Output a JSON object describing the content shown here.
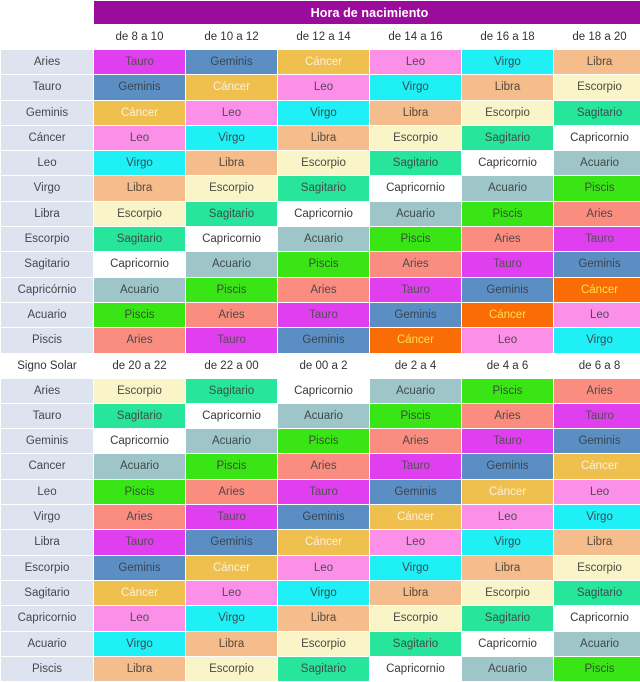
{
  "title": "Hora de nacimiento",
  "solar_sign_label": "Signo Solar",
  "sign_colors": {
    "Aries": "#FA8C80",
    "Tauro": "#E03FF0",
    "Geminis": "#5B8FC4",
    "Cáncer": "#EFC04E",
    "Cáncer_alt": "#F96C06",
    "Leo": "#FC8FE8",
    "Virgo": "#1FF0F5",
    "Libra": "#F5BC8C",
    "Escorpio": "#FAF5C8",
    "Sagitario": "#27E59A",
    "Capricornio": "#FFFFFF",
    "Acuario": "#9EC5C8",
    "Piscis": "#3AE515",
    "title_bar": "#9C0C9C",
    "row_label": "#DDE3EF"
  },
  "section1": {
    "columns": [
      "de 8 a 10",
      "de 10 a 12",
      "de 12 a 14",
      "de 14 a 16",
      "de 16 a 18",
      "de 18 a 20"
    ],
    "rows": [
      {
        "label": "Aries",
        "cells": [
          {
            "t": "Tauro",
            "c": "s-tauro"
          },
          {
            "t": "Geminis",
            "c": "s-geminis"
          },
          {
            "t": "Cáncer",
            "c": "s-cancer-gold"
          },
          {
            "t": "Leo",
            "c": "s-leo"
          },
          {
            "t": "Virgo",
            "c": "s-virgo"
          },
          {
            "t": "Libra",
            "c": "s-libra"
          }
        ]
      },
      {
        "label": "Tauro",
        "cells": [
          {
            "t": "Geminis",
            "c": "s-geminis"
          },
          {
            "t": "Cáncer",
            "c": "s-cancer-gold"
          },
          {
            "t": "Leo",
            "c": "s-leo"
          },
          {
            "t": "Virgo",
            "c": "s-virgo"
          },
          {
            "t": "Libra",
            "c": "s-libra"
          },
          {
            "t": "Escorpio",
            "c": "s-escorpio"
          }
        ]
      },
      {
        "label": "Geminis",
        "cells": [
          {
            "t": "Cáncer",
            "c": "s-cancer-gold"
          },
          {
            "t": "Leo",
            "c": "s-leo"
          },
          {
            "t": "Virgo",
            "c": "s-virgo"
          },
          {
            "t": "Libra",
            "c": "s-libra"
          },
          {
            "t": "Escorpio",
            "c": "s-escorpio"
          },
          {
            "t": "Sagitario",
            "c": "s-sagitario"
          }
        ]
      },
      {
        "label": "Cáncer",
        "cells": [
          {
            "t": "Leo",
            "c": "s-leo"
          },
          {
            "t": "Virgo",
            "c": "s-virgo"
          },
          {
            "t": "Libra",
            "c": "s-libra"
          },
          {
            "t": "Escorpio",
            "c": "s-escorpio"
          },
          {
            "t": "Sagitario",
            "c": "s-sagitario"
          },
          {
            "t": "Capricornio",
            "c": "s-capricornio"
          }
        ]
      },
      {
        "label": "Leo",
        "cells": [
          {
            "t": "Virgo",
            "c": "s-virgo"
          },
          {
            "t": "Libra",
            "c": "s-libra"
          },
          {
            "t": "Escorpio",
            "c": "s-escorpio"
          },
          {
            "t": "Sagitario",
            "c": "s-sagitario"
          },
          {
            "t": "Capricornio",
            "c": "s-capricornio"
          },
          {
            "t": "Acuario",
            "c": "s-acuario"
          }
        ]
      },
      {
        "label": "Virgo",
        "cells": [
          {
            "t": "Libra",
            "c": "s-libra"
          },
          {
            "t": "Escorpio",
            "c": "s-escorpio"
          },
          {
            "t": "Sagitario",
            "c": "s-sagitario"
          },
          {
            "t": "Capricornio",
            "c": "s-capricornio"
          },
          {
            "t": "Acuario",
            "c": "s-acuario"
          },
          {
            "t": "Piscis",
            "c": "s-piscis"
          }
        ]
      },
      {
        "label": "Libra",
        "cells": [
          {
            "t": "Escorpio",
            "c": "s-escorpio"
          },
          {
            "t": "Sagitario",
            "c": "s-sagitario"
          },
          {
            "t": "Capricornio",
            "c": "s-capricornio"
          },
          {
            "t": "Acuario",
            "c": "s-acuario"
          },
          {
            "t": "Piscis",
            "c": "s-piscis"
          },
          {
            "t": "Aries",
            "c": "s-aries"
          }
        ]
      },
      {
        "label": "Escorpio",
        "cells": [
          {
            "t": "Sagitario",
            "c": "s-sagitario"
          },
          {
            "t": "Capricornio",
            "c": "s-capricornio"
          },
          {
            "t": "Acuario",
            "c": "s-acuario"
          },
          {
            "t": "Piscis",
            "c": "s-piscis"
          },
          {
            "t": "Aries",
            "c": "s-aries"
          },
          {
            "t": "Tauro",
            "c": "s-tauro"
          }
        ]
      },
      {
        "label": "Sagitario",
        "cells": [
          {
            "t": "Capricornio",
            "c": "s-capricornio"
          },
          {
            "t": "Acuario",
            "c": "s-acuario"
          },
          {
            "t": "Piscis",
            "c": "s-piscis"
          },
          {
            "t": "Aries",
            "c": "s-aries"
          },
          {
            "t": "Tauro",
            "c": "s-tauro"
          },
          {
            "t": "Geminis",
            "c": "s-geminis"
          }
        ]
      },
      {
        "label": "Capricórnio",
        "cells": [
          {
            "t": "Acuario",
            "c": "s-acuario"
          },
          {
            "t": "Piscis",
            "c": "s-piscis"
          },
          {
            "t": "Aries",
            "c": "s-aries"
          },
          {
            "t": "Tauro",
            "c": "s-tauro"
          },
          {
            "t": "Geminis",
            "c": "s-geminis"
          },
          {
            "t": "Cáncer",
            "c": "s-cancer-org"
          }
        ]
      },
      {
        "label": "Acuario",
        "cells": [
          {
            "t": "Piscis",
            "c": "s-piscis"
          },
          {
            "t": "Aries",
            "c": "s-aries"
          },
          {
            "t": "Tauro",
            "c": "s-tauro"
          },
          {
            "t": "Geminis",
            "c": "s-geminis"
          },
          {
            "t": "Cáncer",
            "c": "s-cancer-org"
          },
          {
            "t": "Leo",
            "c": "s-leo"
          }
        ]
      },
      {
        "label": "Piscis",
        "cells": [
          {
            "t": "Aries",
            "c": "s-aries"
          },
          {
            "t": "Tauro",
            "c": "s-tauro"
          },
          {
            "t": "Geminis",
            "c": "s-geminis"
          },
          {
            "t": "Cáncer",
            "c": "s-cancer-org"
          },
          {
            "t": "Leo",
            "c": "s-leo"
          },
          {
            "t": "Virgo",
            "c": "s-virgo"
          }
        ]
      }
    ]
  },
  "section2": {
    "columns": [
      "de 20 a 22",
      "de 22 a 00",
      "de 00 a 2",
      "de 2 a 4",
      "de 4 a 6",
      "de 6 a 8"
    ],
    "rows": [
      {
        "label": "Aries",
        "cells": [
          {
            "t": "Escorpio",
            "c": "s-escorpio"
          },
          {
            "t": "Sagitario",
            "c": "s-sagitario"
          },
          {
            "t": "Capricornio",
            "c": "s-capricornio"
          },
          {
            "t": "Acuario",
            "c": "s-acuario"
          },
          {
            "t": "Piscis",
            "c": "s-piscis"
          },
          {
            "t": "Aries",
            "c": "s-aries"
          }
        ]
      },
      {
        "label": "Tauro",
        "cells": [
          {
            "t": "Sagitario",
            "c": "s-sagitario"
          },
          {
            "t": "Capricornio",
            "c": "s-capricornio"
          },
          {
            "t": "Acuario",
            "c": "s-acuario"
          },
          {
            "t": "Piscis",
            "c": "s-piscis"
          },
          {
            "t": "Aries",
            "c": "s-aries"
          },
          {
            "t": "Tauro",
            "c": "s-tauro"
          }
        ]
      },
      {
        "label": "Geminis",
        "cells": [
          {
            "t": "Capricornio",
            "c": "s-capricornio"
          },
          {
            "t": "Acuario",
            "c": "s-acuario"
          },
          {
            "t": "Piscis",
            "c": "s-piscis"
          },
          {
            "t": "Aries",
            "c": "s-aries"
          },
          {
            "t": "Tauro",
            "c": "s-tauro"
          },
          {
            "t": "Geminis",
            "c": "s-geminis"
          }
        ]
      },
      {
        "label": "Cancer",
        "cells": [
          {
            "t": "Acuario",
            "c": "s-acuario"
          },
          {
            "t": "Piscis",
            "c": "s-piscis"
          },
          {
            "t": "Aries",
            "c": "s-aries"
          },
          {
            "t": "Tauro",
            "c": "s-tauro"
          },
          {
            "t": "Geminis",
            "c": "s-geminis"
          },
          {
            "t": "Cáncer",
            "c": "s-cancer-gold"
          }
        ]
      },
      {
        "label": "Leo",
        "cells": [
          {
            "t": "Piscis",
            "c": "s-piscis"
          },
          {
            "t": "Aries",
            "c": "s-aries"
          },
          {
            "t": "Tauro",
            "c": "s-tauro"
          },
          {
            "t": "Geminis",
            "c": "s-geminis"
          },
          {
            "t": "Cáncer",
            "c": "s-cancer-gold"
          },
          {
            "t": "Leo",
            "c": "s-leo"
          }
        ]
      },
      {
        "label": "Virgo",
        "cells": [
          {
            "t": "Aries",
            "c": "s-aries"
          },
          {
            "t": "Tauro",
            "c": "s-tauro"
          },
          {
            "t": "Geminis",
            "c": "s-geminis"
          },
          {
            "t": "Cáncer",
            "c": "s-cancer-gold"
          },
          {
            "t": "Leo",
            "c": "s-leo"
          },
          {
            "t": "Virgo",
            "c": "s-virgo"
          }
        ]
      },
      {
        "label": "Libra",
        "cells": [
          {
            "t": "Tauro",
            "c": "s-tauro"
          },
          {
            "t": "Geminis",
            "c": "s-geminis"
          },
          {
            "t": "Cáncer",
            "c": "s-cancer-gold"
          },
          {
            "t": "Leo",
            "c": "s-leo"
          },
          {
            "t": "Virgo",
            "c": "s-virgo"
          },
          {
            "t": "Libra",
            "c": "s-libra"
          }
        ]
      },
      {
        "label": "Escorpio",
        "cells": [
          {
            "t": "Geminis",
            "c": "s-geminis"
          },
          {
            "t": "Cáncer",
            "c": "s-cancer-gold"
          },
          {
            "t": "Leo",
            "c": "s-leo"
          },
          {
            "t": "Virgo",
            "c": "s-virgo"
          },
          {
            "t": "Libra",
            "c": "s-libra"
          },
          {
            "t": "Escorpio",
            "c": "s-escorpio"
          }
        ]
      },
      {
        "label": "Sagitario",
        "cells": [
          {
            "t": "Cáncer",
            "c": "s-cancer-gold"
          },
          {
            "t": "Leo",
            "c": "s-leo"
          },
          {
            "t": "Virgo",
            "c": "s-virgo"
          },
          {
            "t": "Libra",
            "c": "s-libra"
          },
          {
            "t": "Escorpio",
            "c": "s-escorpio"
          },
          {
            "t": "Sagitario",
            "c": "s-sagitario"
          }
        ]
      },
      {
        "label": "Capricornio",
        "cells": [
          {
            "t": "Leo",
            "c": "s-leo"
          },
          {
            "t": "Virgo",
            "c": "s-virgo"
          },
          {
            "t": "Libra",
            "c": "s-libra"
          },
          {
            "t": "Escorpio",
            "c": "s-escorpio"
          },
          {
            "t": "Sagitario",
            "c": "s-sagitario"
          },
          {
            "t": "Capricornio",
            "c": "s-capricornio"
          }
        ]
      },
      {
        "label": "Acuario",
        "cells": [
          {
            "t": "Virgo",
            "c": "s-virgo"
          },
          {
            "t": "Libra",
            "c": "s-libra"
          },
          {
            "t": "Escorpio",
            "c": "s-escorpio"
          },
          {
            "t": "Sagitario",
            "c": "s-sagitario"
          },
          {
            "t": "Capricornio",
            "c": "s-capricornio"
          },
          {
            "t": "Acuario",
            "c": "s-acuario"
          }
        ]
      },
      {
        "label": "Piscis",
        "cells": [
          {
            "t": "Libra",
            "c": "s-libra"
          },
          {
            "t": "Escorpio",
            "c": "s-escorpio"
          },
          {
            "t": "Sagitario",
            "c": "s-sagitario"
          },
          {
            "t": "Capricornio",
            "c": "s-capricornio"
          },
          {
            "t": "Acuario",
            "c": "s-acuario"
          },
          {
            "t": "Piscis",
            "c": "s-piscis"
          }
        ]
      }
    ]
  }
}
